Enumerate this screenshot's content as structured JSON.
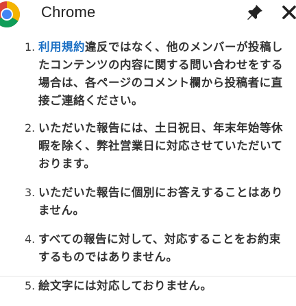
{
  "window": {
    "title": "Chrome",
    "icons": {
      "logo": "chrome-logo-icon",
      "pin": "pin-icon",
      "close": "close-icon"
    }
  },
  "notes": {
    "items": [
      {
        "number": "1.",
        "link": "利用規約",
        "text": "違反ではなく、他のメンバーが投稿したコンテンツの内容に関する問い合わせをする場合は、各ページのコメント欄から投稿者に直接ご連絡ください。"
      },
      {
        "number": "2.",
        "text": "いただいた報告には、土日祝日、年末年始等休暇を除く、弊社営業日に対応させていただいております。"
      },
      {
        "number": "3.",
        "text": "いただいた報告に個別にお答えすることはありません。"
      },
      {
        "number": "4.",
        "text": "すべての報告に対して、対応することをお約束するものではありません。"
      },
      {
        "number": "5.",
        "text": "絵文字には対応しておりません。"
      }
    ]
  },
  "colors": {
    "link": "#1a6fc4",
    "text": "#333333",
    "background": "#ffffff"
  }
}
